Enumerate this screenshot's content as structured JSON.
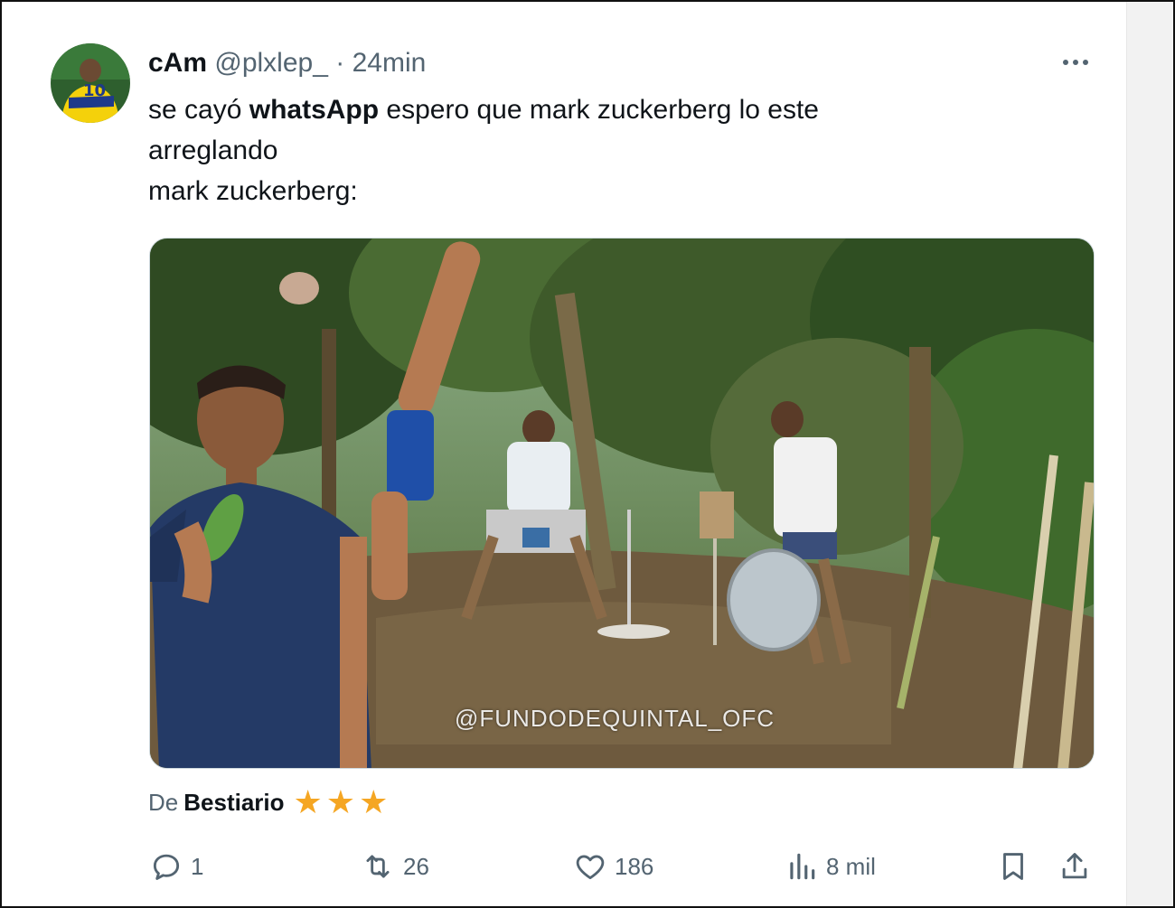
{
  "tweet": {
    "author_name": "cAm",
    "handle": "@plxlep_",
    "separator": "·",
    "time": "24min",
    "text": {
      "part1": "se cayó ",
      "bold": "whatsApp",
      "part2": " espero que mark zuckerberg lo este",
      "line2": "arreglando",
      "line3": "mark zuckerberg:"
    }
  },
  "media": {
    "watermark": "@FUNDODEQUINTAL_OFC"
  },
  "source": {
    "prefix": "De",
    "community": "Bestiario",
    "stars": [
      "★",
      "★",
      "★"
    ]
  },
  "actions": {
    "replies": "1",
    "reposts": "26",
    "likes": "186",
    "views": "8 mil"
  },
  "colors": {
    "text": "#0f1419",
    "secondary": "#536471",
    "star": "#f5a623"
  },
  "icons": [
    "more-icon",
    "reply-icon",
    "repost-icon",
    "like-icon",
    "views-icon",
    "bookmark-icon",
    "share-icon"
  ]
}
